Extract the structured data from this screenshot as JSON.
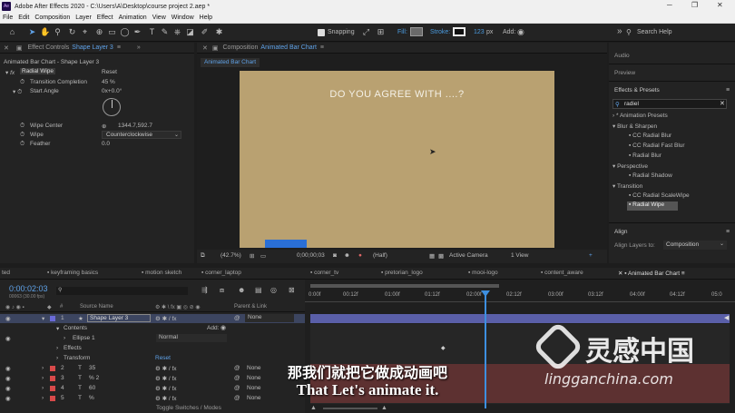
{
  "titlebar": {
    "app_icon": "Ae",
    "title": "Adobe After Effects 2020 - C:\\Users\\A\\Desktop\\course project 2.aep *",
    "minimize": "─",
    "maximize": "❐",
    "close": "✕"
  },
  "menu": [
    "File",
    "Edit",
    "Composition",
    "Layer",
    "Effect",
    "Animation",
    "View",
    "Window",
    "Help"
  ],
  "toolbar": {
    "snapping": "Snapping",
    "fill": "Fill:",
    "stroke": "Stroke:",
    "stroke_width": "123",
    "stroke_unit": "px",
    "add": "Add:",
    "search_help": "Search Help"
  },
  "effect_controls": {
    "tab_prefix": "Effect Controls",
    "tab_layer": "Shape Layer 3",
    "header": "Animated Bar Chart - Shape Layer 3",
    "fx_name": "Radial Wipe",
    "reset": "Reset",
    "transition_label": "Transition Completion",
    "transition_value": "45 %",
    "start_angle_label": "Start Angle",
    "start_angle_value": "0x+0.0°",
    "wipe_center_label": "Wipe Center",
    "wipe_center_value": "1344.7,592.7",
    "wipe_label": "Wipe",
    "wipe_value": "Counterclockwise",
    "feather_label": "Feather",
    "feather_value": "0.0"
  },
  "composition": {
    "tab_prefix": "Composition",
    "tab_name": "Animated Bar Chart",
    "sub_tab": "Animated Bar Chart",
    "canvas_text": "DO YOU AGREE WITH ....?",
    "zoom": "(42.7%)",
    "timecode": "0;00;00;03",
    "resolution": "(Half)",
    "camera": "Active Camera",
    "views": "1 View"
  },
  "right_panel": {
    "audio": "Audio",
    "preview": "Preview",
    "effects_presets": "Effects & Presets",
    "search_value": "radiel",
    "tree": [
      {
        "label": "* Animation Presets",
        "level": 0
      },
      {
        "label": "Blur & Sharpen",
        "level": 0
      },
      {
        "label": "CC Radial Blur",
        "level": 1
      },
      {
        "label": "CC Radial Fast Blur",
        "level": 1
      },
      {
        "label": "Radial Blur",
        "level": 1
      },
      {
        "label": "Perspective",
        "level": 0
      },
      {
        "label": "Radial Shadow",
        "level": 1
      },
      {
        "label": "Transition",
        "level": 0
      },
      {
        "label": "CC Radial ScaleWipe",
        "level": 1
      },
      {
        "label": "Radial Wipe",
        "level": 1
      }
    ],
    "align": "Align",
    "align_layers_to": "Align Layers to:",
    "align_target": "Composition"
  },
  "timeline": {
    "tabs": [
      "ted",
      "keyframing basics",
      "motion sketch",
      "corner_laptop",
      "corner_tv",
      "pretorian_logo",
      "mooi-logo",
      "content_aware",
      "Animated Bar Chart"
    ],
    "timecode": "0:00:02:03",
    "frames": "00063 (30.00 fps)",
    "col_source": "Source Name",
    "col_parent": "Parent & Link",
    "ruler": [
      "0:00f",
      "00:12f",
      "01:00f",
      "01:12f",
      "02:00f",
      "02:12f",
      "03:00f",
      "03:12f",
      "04:00f",
      "04:12f",
      "05:0"
    ],
    "layers": [
      {
        "num": "1",
        "name": "Shape Layer 3",
        "parent": "None",
        "color": "#6a6ad8",
        "type": "★"
      },
      {
        "num": "2",
        "name": "35",
        "parent": "None",
        "color": "#d84a4a",
        "type": "T"
      },
      {
        "num": "3",
        "name": "% 2",
        "parent": "None",
        "color": "#d84a4a",
        "type": "T"
      },
      {
        "num": "4",
        "name": "60",
        "parent": "None",
        "color": "#d84a4a",
        "type": "T"
      },
      {
        "num": "5",
        "name": "%",
        "parent": "None",
        "color": "#d84a4a",
        "type": "T"
      }
    ],
    "contents": "Contents",
    "add": "Add:",
    "ellipse": "Ellipse 1",
    "blend": "Normal",
    "effects": "Effects",
    "transform": "Transform",
    "reset": "Reset",
    "toggle": "Toggle Switches / Modes"
  },
  "subtitle": {
    "cn": "那我们就把它做成动画吧",
    "en": "That Let's animate it."
  },
  "watermark": {
    "cn": "灵感中国",
    "en": "lingganchina.com"
  },
  "colors": {
    "accent": "#4a9bdf",
    "canvas": "#b9a171",
    "layer_bar": "#5a5fa8",
    "playhead": "#3d8fe0"
  }
}
